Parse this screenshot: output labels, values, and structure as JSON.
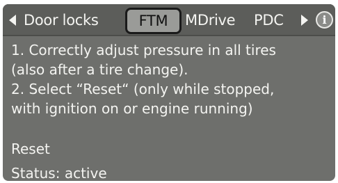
{
  "tabs": [
    {
      "label": "Door locks",
      "selected": false
    },
    {
      "label": "FTM",
      "selected": true
    },
    {
      "label": "MDrive",
      "selected": false
    },
    {
      "label": "PDC",
      "selected": false
    }
  ],
  "nav": {
    "left_icon": "arrow-left-icon",
    "right_icon": "arrow-right-icon",
    "info_icon": "info-icon",
    "info_glyph": "i"
  },
  "instructions": [
    "1. Correctly adjust pressure in all tires",
    "(also after a tire change).",
    "2. Select “Reset“ (only while stopped,",
    "with ignition on or engine running)"
  ],
  "reset_label": "Reset",
  "status_text": "Status: active",
  "colors": {
    "screen_bg": "#6e6f6c",
    "tab_bar_bg": "#5c5d5a",
    "selected_tab_bg": "#9a9b98",
    "text": "#f4f4f1"
  }
}
